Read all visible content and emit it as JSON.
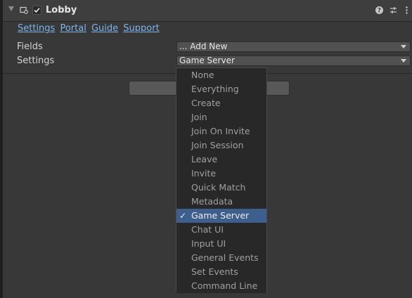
{
  "component": {
    "title": "Lobby",
    "enabled": true,
    "icons": {
      "foldout": "triangle-down-icon",
      "component": "component-icon",
      "help": "help-icon",
      "presets": "presets-icon",
      "menu": "kebab-menu-icon"
    }
  },
  "links": [
    "Settings",
    "Portal",
    "Guide",
    "Support"
  ],
  "fields": {
    "label": "Fields",
    "value": "... Add New"
  },
  "settings": {
    "label": "Settings",
    "value": "Game Server"
  },
  "dropdown": {
    "selected": "Game Server",
    "check_mark": "✓",
    "options": [
      "None",
      "Everything",
      "Create",
      "Join",
      "Join On Invite",
      "Join Session",
      "Leave",
      "Invite",
      "Quick Match",
      "Metadata",
      "Game Server",
      "Chat UI",
      "Input UI",
      "General Events",
      "Set Events",
      "Command Line"
    ]
  },
  "colors": {
    "link": "#7eb3ea",
    "selection": "#3e5e8e",
    "background": "#383838"
  }
}
